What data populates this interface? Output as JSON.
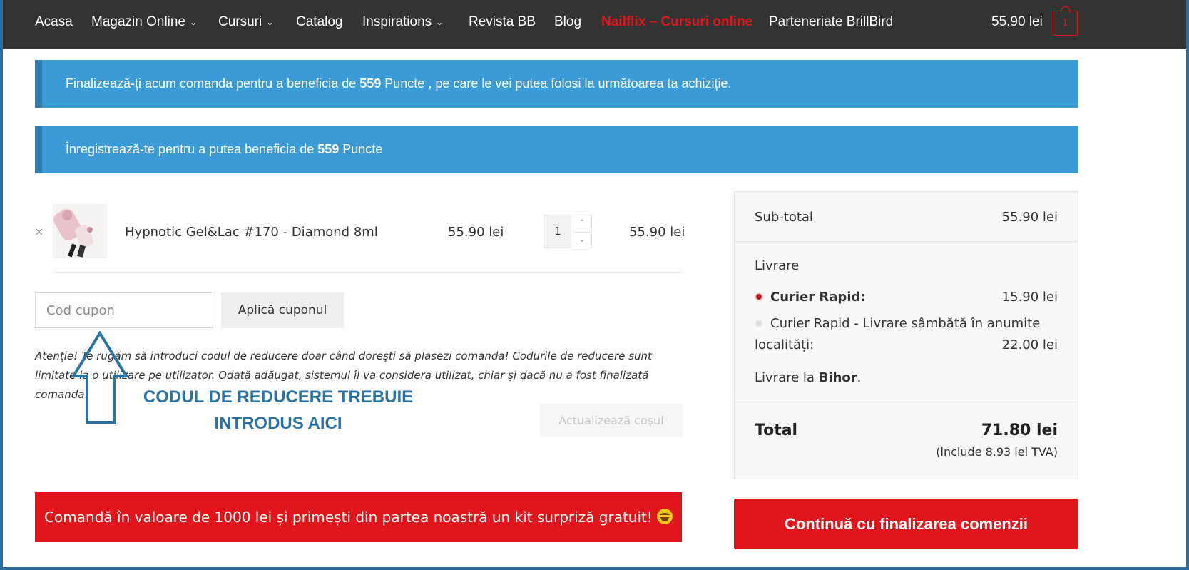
{
  "nav": {
    "items": [
      {
        "label": "Acasa",
        "dropdown": false
      },
      {
        "label": "Magazin Online",
        "dropdown": true
      },
      {
        "label": "Cursuri",
        "dropdown": true
      },
      {
        "label": "Catalog",
        "dropdown": false
      },
      {
        "label": "Inspirations",
        "dropdown": true
      },
      {
        "label": "Revista BB",
        "dropdown": false
      },
      {
        "label": "Blog",
        "dropdown": false
      },
      {
        "label": "Nailflix – Cursuri online",
        "dropdown": false
      },
      {
        "label": "Parteneriate BrillBird",
        "dropdown": false
      }
    ],
    "cart_total": "55.90 lei",
    "cart_count": "1"
  },
  "banners": {
    "points": {
      "pre": "Finalizează-ți acum comanda pentru a beneficia de ",
      "points": "559",
      "post": " Puncte , pe care le vei putea folosi la următoarea ta achiziție."
    },
    "register": {
      "pre": "Înregistrează-te pentru a putea beneficia de ",
      "points": "559",
      "post": " Puncte"
    }
  },
  "cart": {
    "remove": "×",
    "product_name": "Hypnotic Gel&Lac #170 - Diamond 8ml",
    "price": "55.90 lei",
    "quantity": "1",
    "subtotal": "55.90 lei"
  },
  "coupon": {
    "placeholder": "Cod cupon",
    "apply_label": "Aplică cuponul",
    "warning": "Atenție! Te rugăm să introduci codul de reducere doar când dorești să plasezi comanda! Codurile de reducere sunt limitate la o utilizare pe utilizator. Odată adăugat, sistemul îl va considera utilizat, chiar și dacă nu a fost finalizată comanda.",
    "annotation_line1": "CODUL DE REDUCERE TREBUIE",
    "annotation_line2": "INTRODUS AICI"
  },
  "update_cart": "Actualizează coșul",
  "promo": "Comandă în valoare de 1000 lei și primești din partea noastră un kit surpriză gratuit!",
  "totals": {
    "subtotal_label": "Sub-total",
    "subtotal_value": "55.90 lei",
    "shipping_label": "Livrare",
    "option1_label": "Curier Rapid:",
    "option1_value": "15.90 lei",
    "option2_line1": "Curier Rapid - Livrare sâmbătă în anumite",
    "option2_line2": "localități:",
    "option2_value": "22.00 lei",
    "delivery_pre": "Livrare la ",
    "delivery_region": "Bihor",
    "delivery_post": ".",
    "total_label": "Total",
    "total_value": "71.80 lei",
    "tva": "(include 8.93 lei TVA)"
  },
  "checkout_label": "Continuă cu finalizarea comenzii",
  "colors": {
    "nav_bg": "#333333",
    "banner_blue": "#3c9bd6",
    "accent_red": "#e0161c",
    "annotation_blue": "#2a72a4"
  }
}
